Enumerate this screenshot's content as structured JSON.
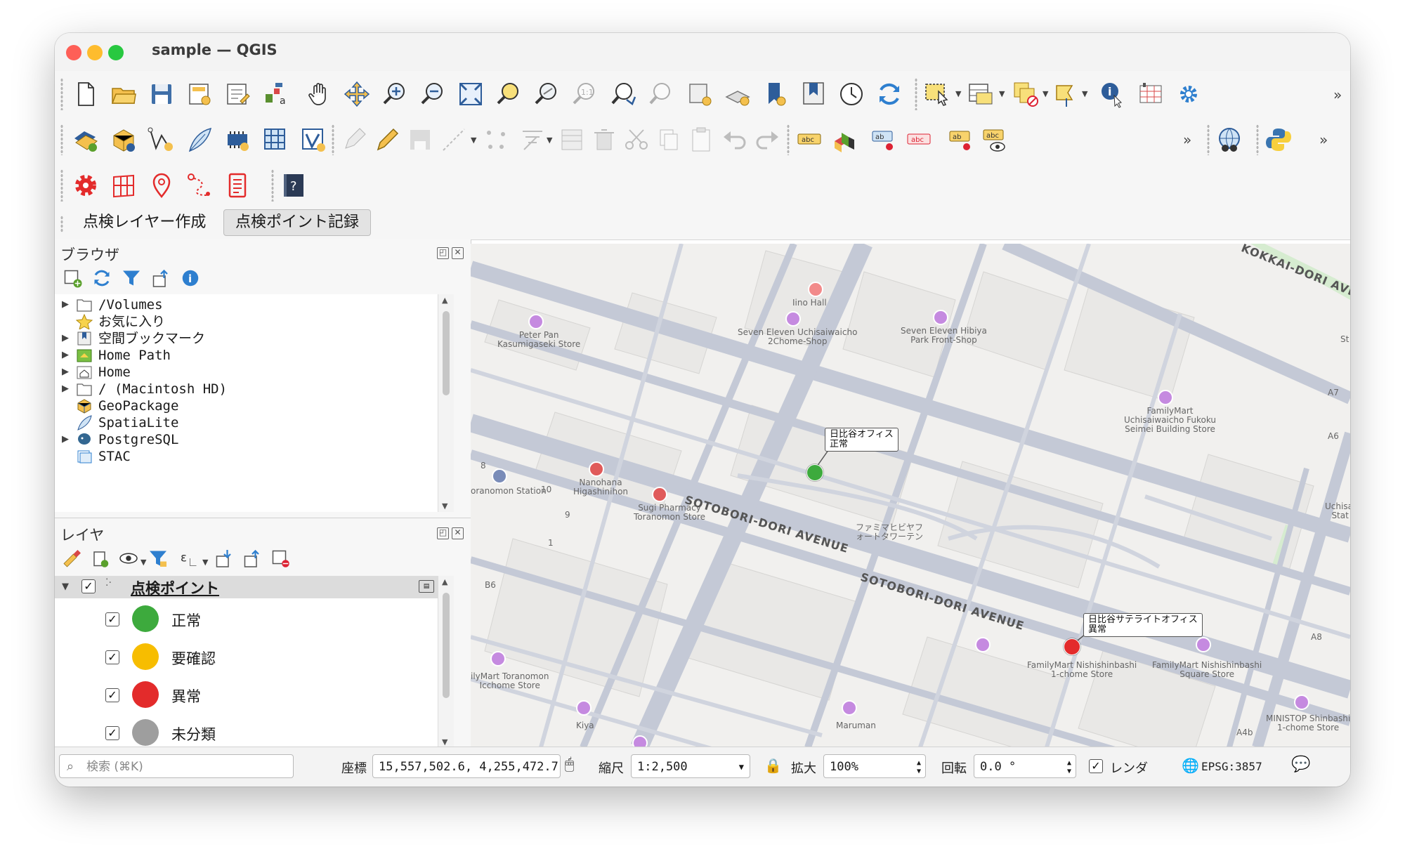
{
  "window": {
    "title": "sample — QGIS"
  },
  "toolbar_row1": {
    "icons": [
      "new-project-icon",
      "open-project-icon",
      "save-project-icon",
      "save-as-icon",
      "print-layout-icon",
      "layout-manager-icon",
      "pan-map-icon",
      "pan-to-selection-icon",
      "zoom-in-icon",
      "zoom-out-icon",
      "zoom-full-icon",
      "zoom-to-selection-icon",
      "zoom-to-layer-icon",
      "zoom-native-icon",
      "zoom-last-icon",
      "zoom-next-icon",
      "new-map-view-icon",
      "new-3d-view-icon",
      "new-bookmark-icon",
      "show-bookmarks-icon",
      "temporal-controller-icon",
      "refresh-icon",
      "select-features-icon",
      "attribute-table-icon",
      "deselect-icon",
      "identify-point-icon",
      "identify-features-icon",
      "measure-icon",
      "settings-icon"
    ],
    "overflow": "»"
  },
  "toolbar_row2": {
    "overflow_a": "»",
    "overflow_b": "»"
  },
  "toolbar_row3": {
    "icons": [
      "plugin-settings-icon",
      "grid-icon",
      "map-pin-icon",
      "route-icon",
      "report-icon",
      "help-icon"
    ]
  },
  "plugin_tabs": [
    "点検レイヤー作成",
    "点検ポイント記録"
  ],
  "browser_panel": {
    "title": "ブラウザ",
    "items": [
      {
        "label": "/Volumes",
        "expandable": true,
        "icon": "folder-icon"
      },
      {
        "label": "お気に入り",
        "expandable": false,
        "icon": "star-icon"
      },
      {
        "label": "空間ブックマーク",
        "expandable": true,
        "icon": "bookmark-icon"
      },
      {
        "label": "Home Path",
        "expandable": true,
        "icon": "home-path-icon"
      },
      {
        "label": "Home",
        "expandable": true,
        "icon": "home-icon"
      },
      {
        "label": "/ (Macintosh HD)",
        "expandable": true,
        "icon": "folder-icon"
      },
      {
        "label": "GeoPackage",
        "expandable": false,
        "icon": "geopackage-icon"
      },
      {
        "label": "SpatiaLite",
        "expandable": false,
        "icon": "spatialite-icon"
      },
      {
        "label": "PostgreSQL",
        "expandable": true,
        "icon": "postgresql-icon"
      },
      {
        "label": "STAC",
        "expandable": false,
        "icon": "stac-icon"
      }
    ]
  },
  "layers_panel": {
    "title": "レイヤ",
    "layer_name": "点検ポイント",
    "categories": [
      {
        "label": "正常",
        "color": "#3daa3d"
      },
      {
        "label": "要確認",
        "color": "#f7bd00"
      },
      {
        "label": "異常",
        "color": "#e32b2b"
      },
      {
        "label": "未分類",
        "color": "#9e9e9e"
      }
    ]
  },
  "map": {
    "streets": [
      "KOKKAI-DORI AVENUE",
      "SOTOBORI-DORI AVENUE",
      "SOTOBORI-DORI AVENUE"
    ],
    "pois": [
      {
        "label": "Iino Hall"
      },
      {
        "label": "Peter Pan\nKasumigaseki Store"
      },
      {
        "label": "Seven Eleven Uchisaiwaicho\n2Chome-Shop"
      },
      {
        "label": "Seven Eleven Hibiya\nPark Front-Shop"
      },
      {
        "label": "FamilyMart\nUchisaiwaicho Fukoku\nSeimei Building Store"
      },
      {
        "label": "Nanohana\nHigashinihon"
      },
      {
        "label": "Sugi Pharmacy\nToranomon Store"
      },
      {
        "label": "oranomon Station"
      },
      {
        "label": "ファミマヒビヤフ\nォートタワーテン"
      },
      {
        "label": "FamilyMart Nishishinbashi\n1-chome Store"
      },
      {
        "label": "FamilyMart Nishishinbashi\nSquare Store"
      },
      {
        "label": "ilyMart Toranomon\nIcchome Store"
      },
      {
        "label": "Kiya"
      },
      {
        "label": "Maruman"
      },
      {
        "label": "MINISTOP Shinbashi\n1-chome Store"
      },
      {
        "label": "Uchisai\nStat"
      }
    ],
    "exit_labels": [
      "A7",
      "A6",
      "A8",
      "A4b",
      "B6",
      "8",
      "10",
      "9",
      "1",
      "St"
    ],
    "callouts": [
      {
        "line1": "日比谷オフィス",
        "line2": "正常",
        "color": "#3daa3d"
      },
      {
        "line1": "日比谷サテライトオフィス",
        "line2": "異常",
        "color": "#e32b2b"
      }
    ]
  },
  "statusbar": {
    "search_placeholder": "検索 (⌘K)",
    "coord_label": "座標",
    "coord_value": "15,557,502.6, 4,255,472.7",
    "scale_label": "縮尺",
    "scale_value": "1:2,500",
    "magnifier_label": "拡大",
    "magnifier_value": "100%",
    "rotation_label": "回転",
    "rotation_value": "0.0 °",
    "render_label": "レンダ",
    "crs_label": "EPSG:3857"
  }
}
